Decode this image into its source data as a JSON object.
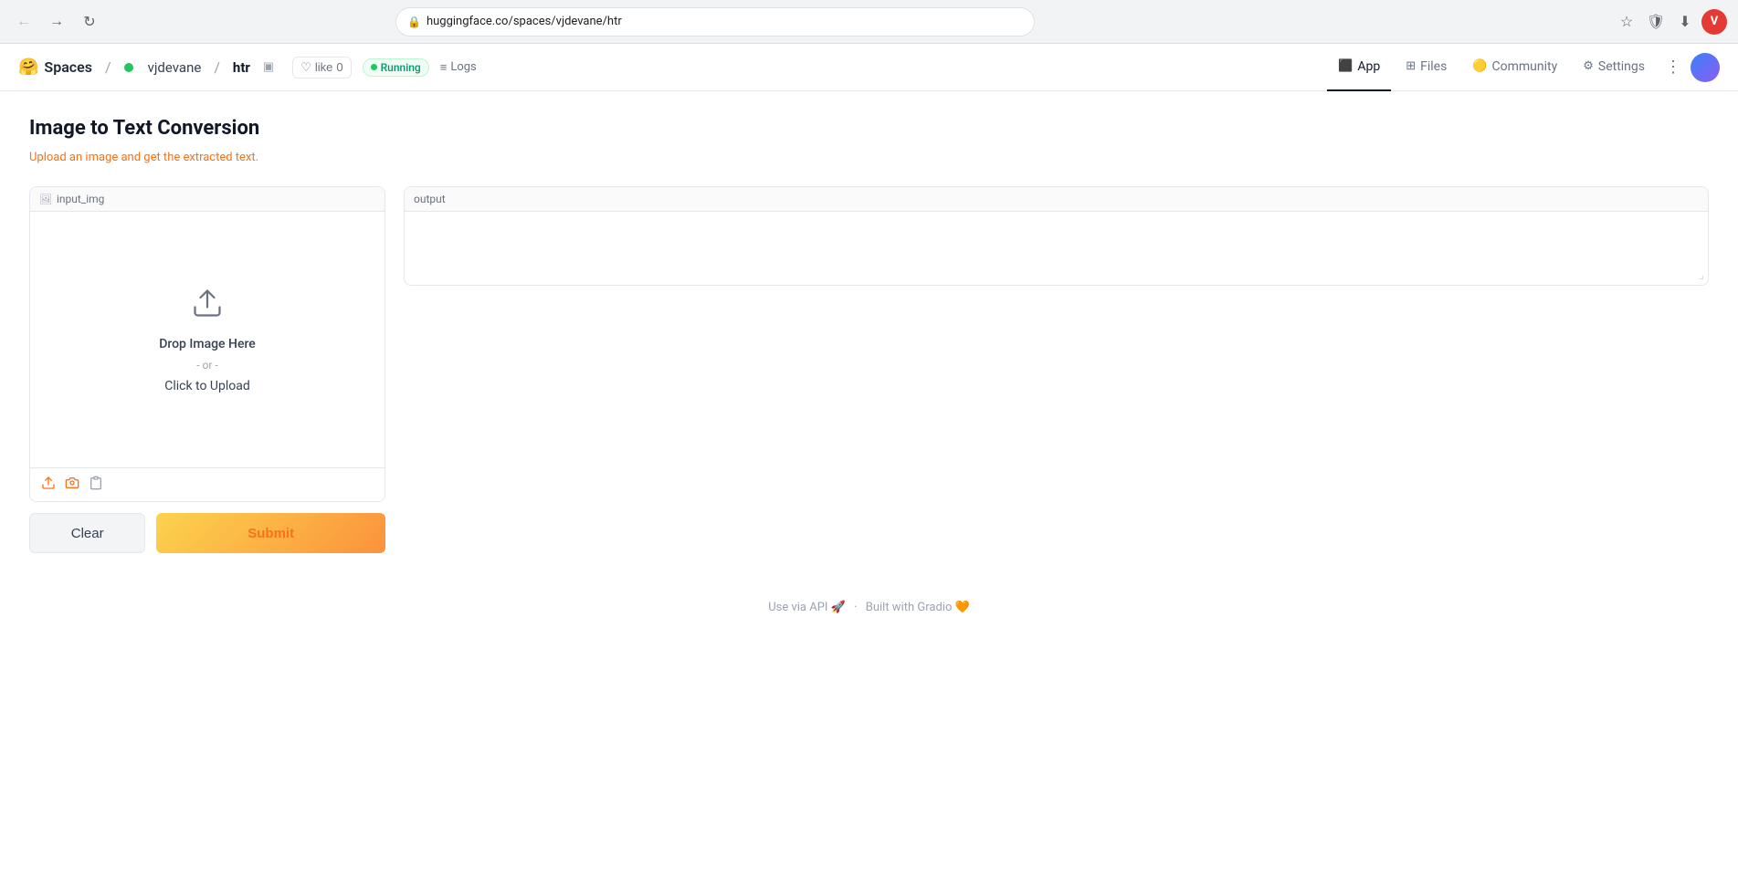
{
  "browser": {
    "url": "huggingface.co/spaces/vjdevane/htr",
    "user_initial": "V"
  },
  "nav": {
    "spaces_label": "Spaces",
    "user_name": "vjdevane",
    "repo_name": "htr",
    "like_label": "like",
    "like_count": "0",
    "running_label": "Running",
    "logs_label": "Logs",
    "tabs": [
      {
        "id": "app",
        "label": "App",
        "active": true
      },
      {
        "id": "files",
        "label": "Files",
        "active": false
      },
      {
        "id": "community",
        "label": "Community",
        "active": false
      },
      {
        "id": "settings",
        "label": "Settings",
        "active": false
      }
    ]
  },
  "page": {
    "title": "Image to Text Conversion",
    "subtitle": "Upload an image and get the extracted text."
  },
  "input_panel": {
    "label": "input_img",
    "drop_main": "Drop Image Here",
    "drop_or": "- or -",
    "drop_click": "Click to Upload"
  },
  "output_panel": {
    "label": "output"
  },
  "buttons": {
    "clear": "Clear",
    "submit": "Submit"
  },
  "footer": {
    "api_label": "Use via API",
    "built_label": "Built with Gradio"
  }
}
